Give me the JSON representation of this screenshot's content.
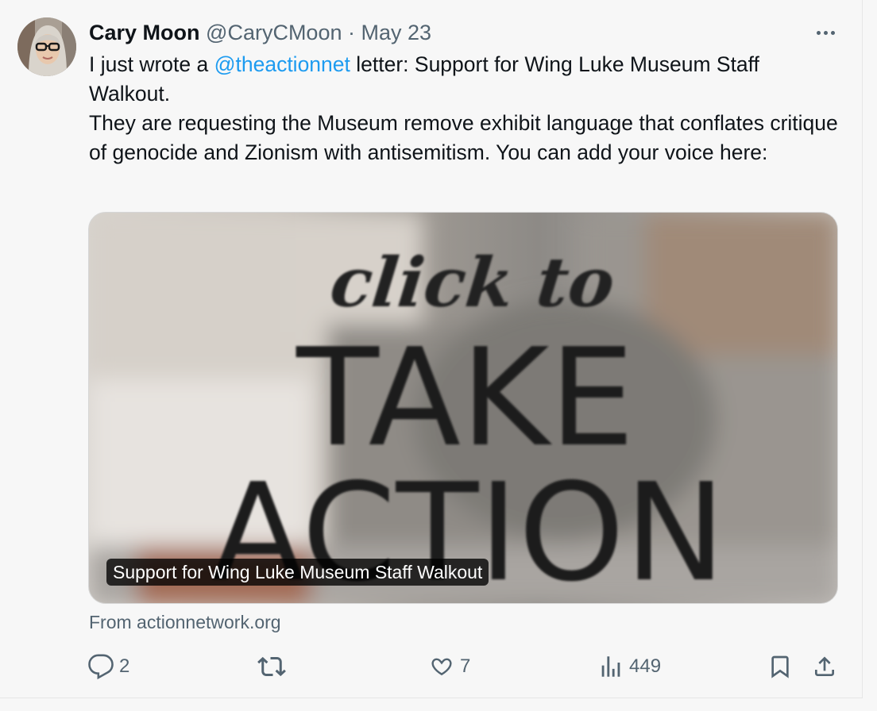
{
  "tweet": {
    "author_name": "Cary Moon",
    "handle": "@CaryCMoon",
    "separator": "·",
    "date": "May 23",
    "text_pre_mention": "I just wrote a ",
    "mention": "@theactionnet",
    "text_line1_rest": " letter: Support for Wing Luke Museum Staff Walkout.",
    "text_para2": "They are requesting the Museum remove exhibit language that conflates critique of genocide and Zionism with antisemitism.  You can add your voice here:"
  },
  "card": {
    "image_script_text": "click to",
    "image_big_text_1": "TAKE",
    "image_big_text_2": "ACTION",
    "title": "Support for Wing Luke Museum Staff Walkout",
    "source": "From actionnetwork.org"
  },
  "actions": {
    "reply_count": "2",
    "retweet_count": "",
    "like_count": "7",
    "views_count": "449"
  },
  "icons": {
    "more": "more-horizontal-icon",
    "reply": "reply-icon",
    "retweet": "retweet-icon",
    "like": "heart-icon",
    "views": "views-chart-icon",
    "bookmark": "bookmark-icon",
    "share": "share-icon"
  },
  "colors": {
    "link": "#1d9bf0",
    "muted": "#536471",
    "text": "#0f1419",
    "background": "#f7f7f7"
  }
}
